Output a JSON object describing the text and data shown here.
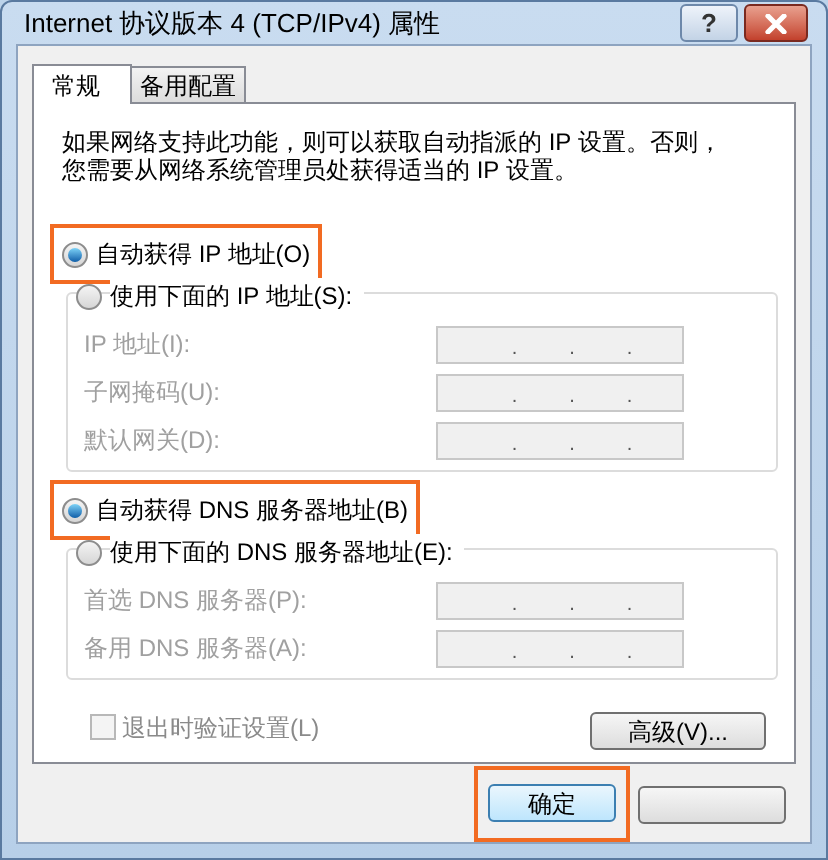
{
  "window": {
    "title": "Internet 协议版本 4 (TCP/IPv4) 属性",
    "help": "?"
  },
  "tabs": [
    {
      "label": "常规",
      "selected": true
    },
    {
      "label": "备用配置",
      "selected": false
    }
  ],
  "description": "如果网络支持此功能，则可以获取自动指派的 IP 设置。否则，您需要从网络系统管理员处获得适当的 IP 设置。",
  "sections": [
    {
      "auto": {
        "label": "自动获得 IP 地址(O)",
        "selected": true,
        "highlighted": true
      },
      "manual": {
        "label": "使用下面的 IP 地址(S):",
        "selected": false,
        "highlighted": false
      },
      "fields": [
        {
          "label": "IP 地址(I):",
          "separators": [
            ".",
            ".",
            "."
          ],
          "disabled": true
        },
        {
          "label": "子网掩码(U):",
          "separators": [
            ".",
            ".",
            "."
          ],
          "disabled": true
        },
        {
          "label": "默认网关(D):",
          "separators": [
            ".",
            ".",
            "."
          ],
          "disabled": true
        }
      ]
    },
    {
      "auto": {
        "label": "自动获得 DNS 服务器地址(B)",
        "selected": true,
        "highlighted": true
      },
      "manual": {
        "label": "使用下面的 DNS 服务器地址(E):",
        "selected": false,
        "highlighted": false
      },
      "fields": [
        {
          "label": "首选 DNS 服务器(P):",
          "separators": [
            ".",
            ".",
            "."
          ],
          "disabled": true
        },
        {
          "label": "备用 DNS 服务器(A):",
          "separators": [
            ".",
            ".",
            "."
          ],
          "disabled": true
        }
      ]
    }
  ],
  "validate_checkbox": {
    "label": "退出时验证设置(L)",
    "checked": false,
    "disabled": true
  },
  "advanced_button": "高级(V)...",
  "ok_button": {
    "label": "确定",
    "highlighted": true
  }
}
